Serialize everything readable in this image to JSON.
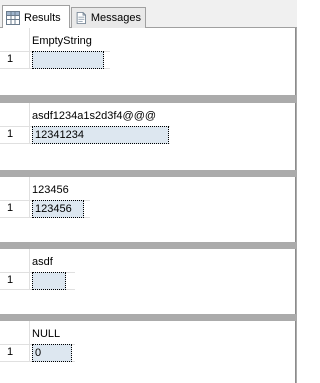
{
  "tabs": [
    {
      "label": "Results",
      "icon": "grid-icon",
      "active": true
    },
    {
      "label": "Messages",
      "icon": "document-icon",
      "active": false
    }
  ],
  "results": [
    {
      "column": "EmptyString",
      "rows": [
        {
          "num": "1",
          "value": ""
        }
      ]
    },
    {
      "column": "asdf1234a1s2d3f4@@@",
      "rows": [
        {
          "num": "1",
          "value": "12341234"
        }
      ]
    },
    {
      "column": "123456",
      "rows": [
        {
          "num": "1",
          "value": "123456"
        }
      ]
    },
    {
      "column": "asdf",
      "rows": [
        {
          "num": "1",
          "value": ""
        }
      ]
    },
    {
      "column": "NULL",
      "rows": [
        {
          "num": "1",
          "value": "0"
        }
      ]
    }
  ]
}
